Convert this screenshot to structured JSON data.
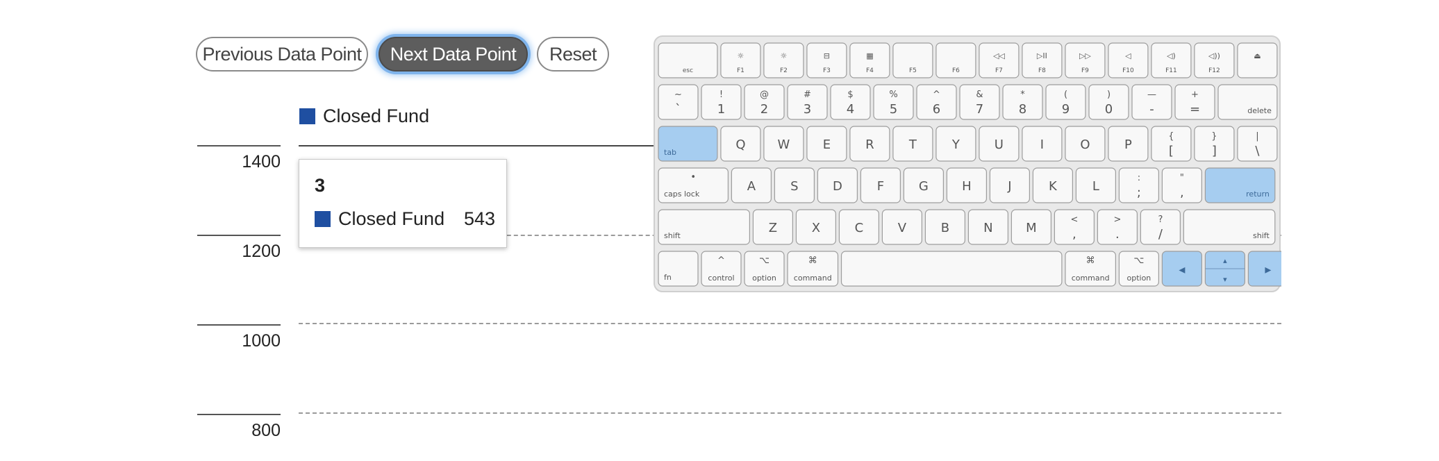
{
  "controls": {
    "prev_label": "Previous Data Point",
    "next_label": "Next Data Point",
    "reset_label": "Reset"
  },
  "legend": {
    "series_name": "Closed Fund",
    "color": "#1f4fa1"
  },
  "y_axis": {
    "ticks": [
      "1400",
      "1200",
      "1000",
      "800"
    ]
  },
  "tooltip": {
    "title": "3",
    "series_name": "Closed Fund",
    "value": "543"
  },
  "chart_data": {
    "type": "bar",
    "series": [
      {
        "name": "Closed Fund",
        "values": [
          543
        ]
      }
    ],
    "categories": [
      "3"
    ],
    "y_ticks": [
      1400,
      1200,
      1000,
      800
    ],
    "grid": true,
    "legend_position": "top-left"
  },
  "keyboard": {
    "highlight_color": "#a6cdf0",
    "rows": [
      [
        {
          "bottom": "esc",
          "w": 1.45
        },
        {
          "top": "☼",
          "bottom": "F1"
        },
        {
          "top": "☼",
          "bottom": "F2"
        },
        {
          "top": "⊟",
          "bottom": "F3"
        },
        {
          "top": "▦",
          "bottom": "F4"
        },
        {
          "bottom": "F5"
        },
        {
          "bottom": "F6"
        },
        {
          "top": "◁◁",
          "bottom": "F7"
        },
        {
          "top": "▷II",
          "bottom": "F8"
        },
        {
          "top": "▷▷",
          "bottom": "F9"
        },
        {
          "top": "◁",
          "bottom": "F10"
        },
        {
          "top": "◁)",
          "bottom": "F11"
        },
        {
          "top": "◁))",
          "bottom": "F12"
        },
        {
          "top": "⏏"
        }
      ],
      [
        {
          "top": "~",
          "main": "`"
        },
        {
          "top": "!",
          "main": "1"
        },
        {
          "top": "@",
          "main": "2"
        },
        {
          "top": "#",
          "main": "3"
        },
        {
          "top": "$",
          "main": "4"
        },
        {
          "top": "%",
          "main": "5"
        },
        {
          "top": "^",
          "main": "6"
        },
        {
          "top": "&",
          "main": "7"
        },
        {
          "top": "*",
          "main": "8"
        },
        {
          "top": "(",
          "main": "9"
        },
        {
          "top": ")",
          "main": "0"
        },
        {
          "top": "—",
          "main": "-"
        },
        {
          "top": "+",
          "main": "="
        },
        {
          "bottomRight": "delete",
          "w": 1.45
        }
      ],
      [
        {
          "bottom": "tab",
          "w": 1.45,
          "hl": true
        },
        {
          "main": "Q"
        },
        {
          "main": "W"
        },
        {
          "main": "E"
        },
        {
          "main": "R"
        },
        {
          "main": "T"
        },
        {
          "main": "Y"
        },
        {
          "main": "U"
        },
        {
          "main": "I"
        },
        {
          "main": "O"
        },
        {
          "main": "P"
        },
        {
          "top": "{",
          "main": "["
        },
        {
          "top": "}",
          "main": "]"
        },
        {
          "top": "|",
          "main": "\\"
        }
      ],
      [
        {
          "top": "•",
          "bottom": "caps lock",
          "w": 1.7
        },
        {
          "main": "A"
        },
        {
          "main": "S"
        },
        {
          "main": "D"
        },
        {
          "main": "F"
        },
        {
          "main": "G"
        },
        {
          "main": "H"
        },
        {
          "main": "J"
        },
        {
          "main": "K"
        },
        {
          "main": "L"
        },
        {
          "top": ":",
          "main": ";"
        },
        {
          "top": "\"",
          "main": ","
        },
        {
          "bottomRight": "return",
          "w": 1.7,
          "hl": true
        }
      ],
      [
        {
          "bottom": "shift",
          "w": 2.2
        },
        {
          "main": "Z"
        },
        {
          "main": "X"
        },
        {
          "main": "C"
        },
        {
          "main": "V"
        },
        {
          "main": "B"
        },
        {
          "main": "N"
        },
        {
          "main": "M"
        },
        {
          "top": "<",
          "main": ","
        },
        {
          "top": ">",
          "main": "."
        },
        {
          "top": "?",
          "main": "/"
        },
        {
          "bottomRight": "shift",
          "w": 2.2
        }
      ],
      [
        {
          "bottom": "fn"
        },
        {
          "top": "^",
          "bottom": "control"
        },
        {
          "top": "⌥",
          "bottom": "option"
        },
        {
          "top": "⌘",
          "bottom": "command",
          "w": 1.25
        },
        {
          "w": 5.2,
          "space": true
        },
        {
          "top": "⌘",
          "bottom": "command",
          "w": 1.25
        },
        {
          "top": "⌥",
          "bottom": "option"
        },
        {
          "main": "◂",
          "hl": true
        },
        {
          "updown": true,
          "hl": true
        },
        {
          "main": "▸",
          "hl": true
        }
      ]
    ]
  }
}
